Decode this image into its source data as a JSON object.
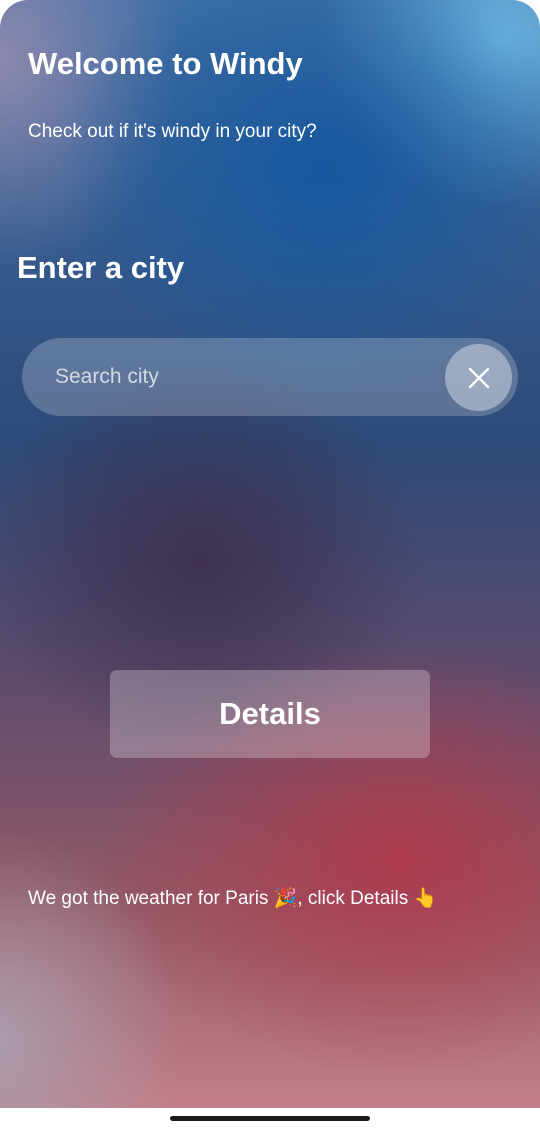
{
  "header": {
    "title": "Welcome to Windy",
    "subtitle": "Check out if it's windy in your city?"
  },
  "search": {
    "heading": "Enter a city",
    "placeholder": "Search city",
    "value": "",
    "clear_icon": "close-icon"
  },
  "actions": {
    "details_label": "Details"
  },
  "status": {
    "message": "We got the weather for Paris 🎉, click Details 👆"
  },
  "colors": {
    "text": "#ffffff",
    "background_top": "#3f6fa6",
    "background_bottom": "#c17f8a",
    "accent_red": "#af3a4e"
  }
}
